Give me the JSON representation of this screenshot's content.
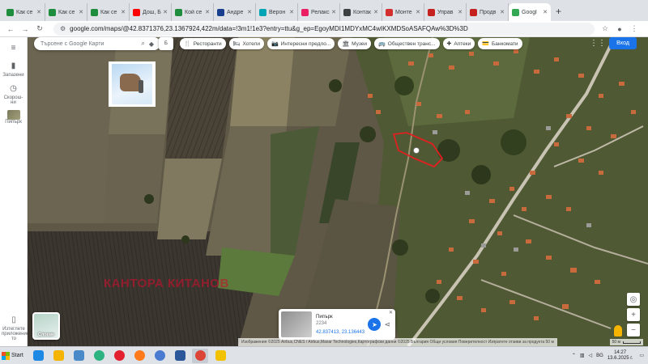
{
  "browser": {
    "tabs": [
      {
        "label": "Как се",
        "color": "#1e8e3e",
        "active": false
      },
      {
        "label": "Как се",
        "color": "#1e8e3e",
        "active": false
      },
      {
        "label": "Как се",
        "color": "#1e8e3e",
        "active": false
      },
      {
        "label": "Дош, Ба",
        "color": "#ff0000",
        "active": false
      },
      {
        "label": "Кой се",
        "color": "#1e8e3e",
        "active": false
      },
      {
        "label": "Андре",
        "color": "#1a3f8f",
        "active": false
      },
      {
        "label": "Верон",
        "color": "#00a5b5",
        "active": false
      },
      {
        "label": "Релакс",
        "color": "#e91e63",
        "active": false
      },
      {
        "label": "Контак",
        "color": "#3c4043",
        "active": false
      },
      {
        "label": "Монте",
        "color": "#d32f2f",
        "active": false
      },
      {
        "label": "Управ",
        "color": "#c5221f",
        "active": false
      },
      {
        "label": "Продв",
        "color": "#c5221f",
        "active": false
      },
      {
        "label": "Googl",
        "color": "#34a853",
        "active": true
      }
    ],
    "new_tab": "+",
    "url": "google.com/maps/@42.8371376,23.1367924,422m/data=!3m1!1e3?entry=ttu&g_ep=EgoyMDI1MDYxMC4wIKXMDSoASAFQAw%3D%3D"
  },
  "rail": {
    "saved_label": "Запазени",
    "recent_label": "Скорош-ни",
    "place_label": "Пипърк",
    "apps_label": "Изтеглете приложение-то"
  },
  "map": {
    "search_placeholder": "Търсене с Google Карти",
    "layer_select": "Б",
    "chips": [
      {
        "label": "Ресторанти",
        "icon": "🍴"
      },
      {
        "label": "Хотели",
        "icon": "🛏"
      },
      {
        "label": "Интересни предло...",
        "icon": "📷"
      },
      {
        "label": "Музеи",
        "icon": "🏛"
      },
      {
        "label": "Обществен транс...",
        "icon": "🚌"
      },
      {
        "label": "Аптеки",
        "icon": "✚"
      },
      {
        "label": "Банкомати",
        "icon": "💳"
      }
    ],
    "signin_label": "Вход",
    "watermark": "КАНТОРА КИТАНОВ",
    "layers_label": "Слоеве",
    "info_card": {
      "title": "Пипърк",
      "subtitle": "2234",
      "coords": "42.837413, 23.136443"
    },
    "attribution": "Изображения ©2025 Airbus,CNES / Airbus,Maxar Technologies,Картографски данни ©2025   България   Общи условия   Поверителност   Изпратете отзиви за продукта   50 м",
    "scale_label": "50 м"
  },
  "taskbar": {
    "start_label": "Start",
    "apps": [
      {
        "name": "media",
        "color": "#1e88e5"
      },
      {
        "name": "explorer",
        "color": "#f4b400"
      },
      {
        "name": "photos",
        "color": "#4a8ac9"
      },
      {
        "name": "edge",
        "color": "#2db37f"
      },
      {
        "name": "opera",
        "color": "#e3202f"
      },
      {
        "name": "firefox",
        "color": "#ff7a1a"
      },
      {
        "name": "chrome-app",
        "color": "#4a7bd1"
      },
      {
        "name": "word",
        "color": "#2b579a"
      },
      {
        "name": "chrome",
        "color": "#db4437"
      },
      {
        "name": "paint",
        "color": "#f2c200"
      }
    ],
    "lang": "BG",
    "time": "14:27",
    "date": "13.6.2025 г."
  }
}
